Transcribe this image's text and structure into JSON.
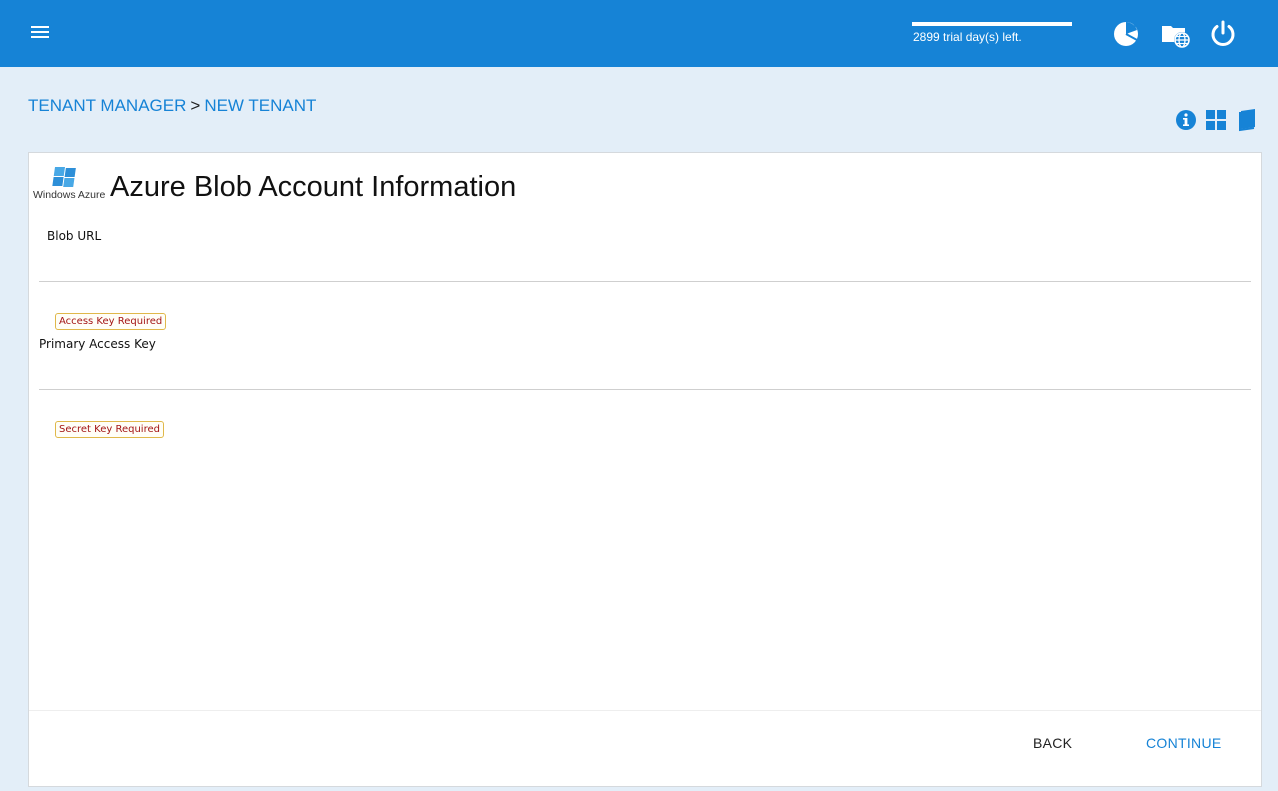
{
  "header": {
    "trial_text": "2899 trial day(s) left.",
    "trial_progress_percent": 100,
    "icons": [
      "menu-icon",
      "dashboard-pie-icon",
      "folder-globe-icon",
      "power-icon"
    ]
  },
  "breadcrumb": {
    "parent": "TENANT MANAGER",
    "separator": ">",
    "current": "NEW TENANT"
  },
  "toolbar": {
    "icons": [
      "info-icon",
      "grid-icon",
      "book-icon"
    ]
  },
  "card": {
    "logo_text": "Windows Azure",
    "title": "Azure Blob Account Information",
    "fields": {
      "blob_url": {
        "label": "Blob URL",
        "value": "",
        "placeholder": ""
      },
      "primary_access_key": {
        "label": "Primary Access Key",
        "value": "",
        "placeholder": "",
        "error": "Access Key Required"
      },
      "secret_key": {
        "value": "",
        "placeholder": "",
        "error": "Secret Key Required"
      }
    }
  },
  "footer": {
    "back_label": "BACK",
    "continue_label": "CONTINUE"
  },
  "colors": {
    "brand": "#1683d6",
    "background": "#e3eef8",
    "error_text": "#a31515",
    "error_border": "#e0b84a"
  }
}
